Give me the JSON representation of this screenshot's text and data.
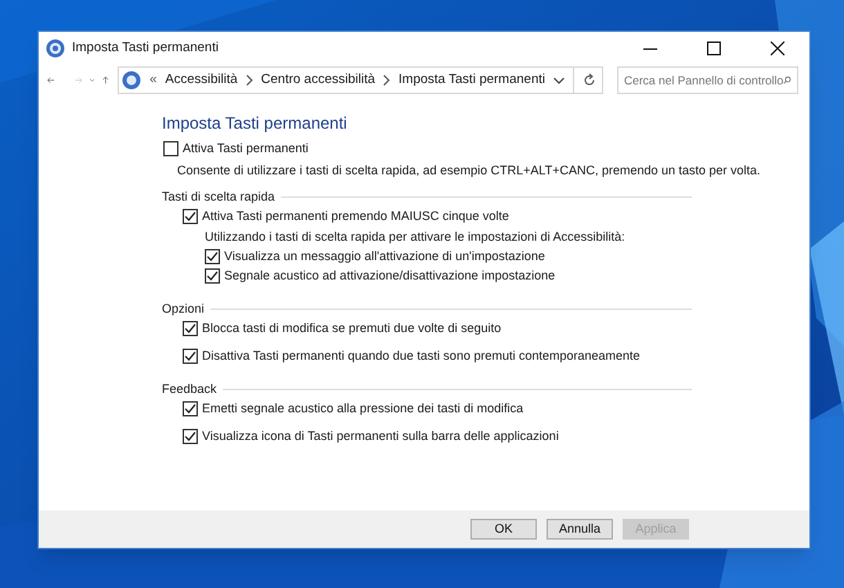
{
  "window": {
    "title": "Imposta Tasti permanenti"
  },
  "address_bar": {
    "prefix": "«",
    "crumbs": [
      "Accessibilità",
      "Centro accessibilità",
      "Imposta Tasti permanenti"
    ]
  },
  "search": {
    "placeholder": "Cerca nel Pannello di controllo"
  },
  "heading": "Imposta Tasti permanenti",
  "main_option": {
    "label": "Attiva Tasti permanenti",
    "checked": false
  },
  "description": "Consente di utilizzare i tasti di scelta rapida, ad esempio CTRL+ALT+CANC, premendo un tasto per volta.",
  "groups": [
    {
      "title": "Tasti di scelta rapida",
      "items": [
        {
          "label": "Attiva Tasti permanenti premendo MAIUSC cinque volte",
          "checked": true,
          "note": "Utilizzando i tasti di scelta rapida per attivare le impostazioni di Accessibilità:",
          "children": [
            {
              "label": "Visualizza un messaggio all'attivazione di un'impostazione",
              "checked": true
            },
            {
              "label": "Segnale acustico ad attivazione/disattivazione impostazione",
              "checked": true
            }
          ]
        }
      ]
    },
    {
      "title": "Opzioni",
      "items": [
        {
          "label": "Blocca tasti di modifica se premuti due volte di seguito",
          "checked": true
        },
        {
          "label": "Disattiva Tasti permanenti quando due tasti sono premuti contemporaneamente",
          "checked": true
        }
      ]
    },
    {
      "title": "Feedback",
      "items": [
        {
          "label": "Emetti segnale acustico alla pressione dei tasti di modifica",
          "checked": true
        },
        {
          "label": "Visualizza icona di Tasti permanenti sulla barra delle applicazioni",
          "checked": true
        }
      ]
    }
  ],
  "buttons": [
    {
      "label": "OK",
      "disabled": false
    },
    {
      "label": "Annulla",
      "disabled": false
    },
    {
      "label": "Applica",
      "disabled": true
    }
  ]
}
